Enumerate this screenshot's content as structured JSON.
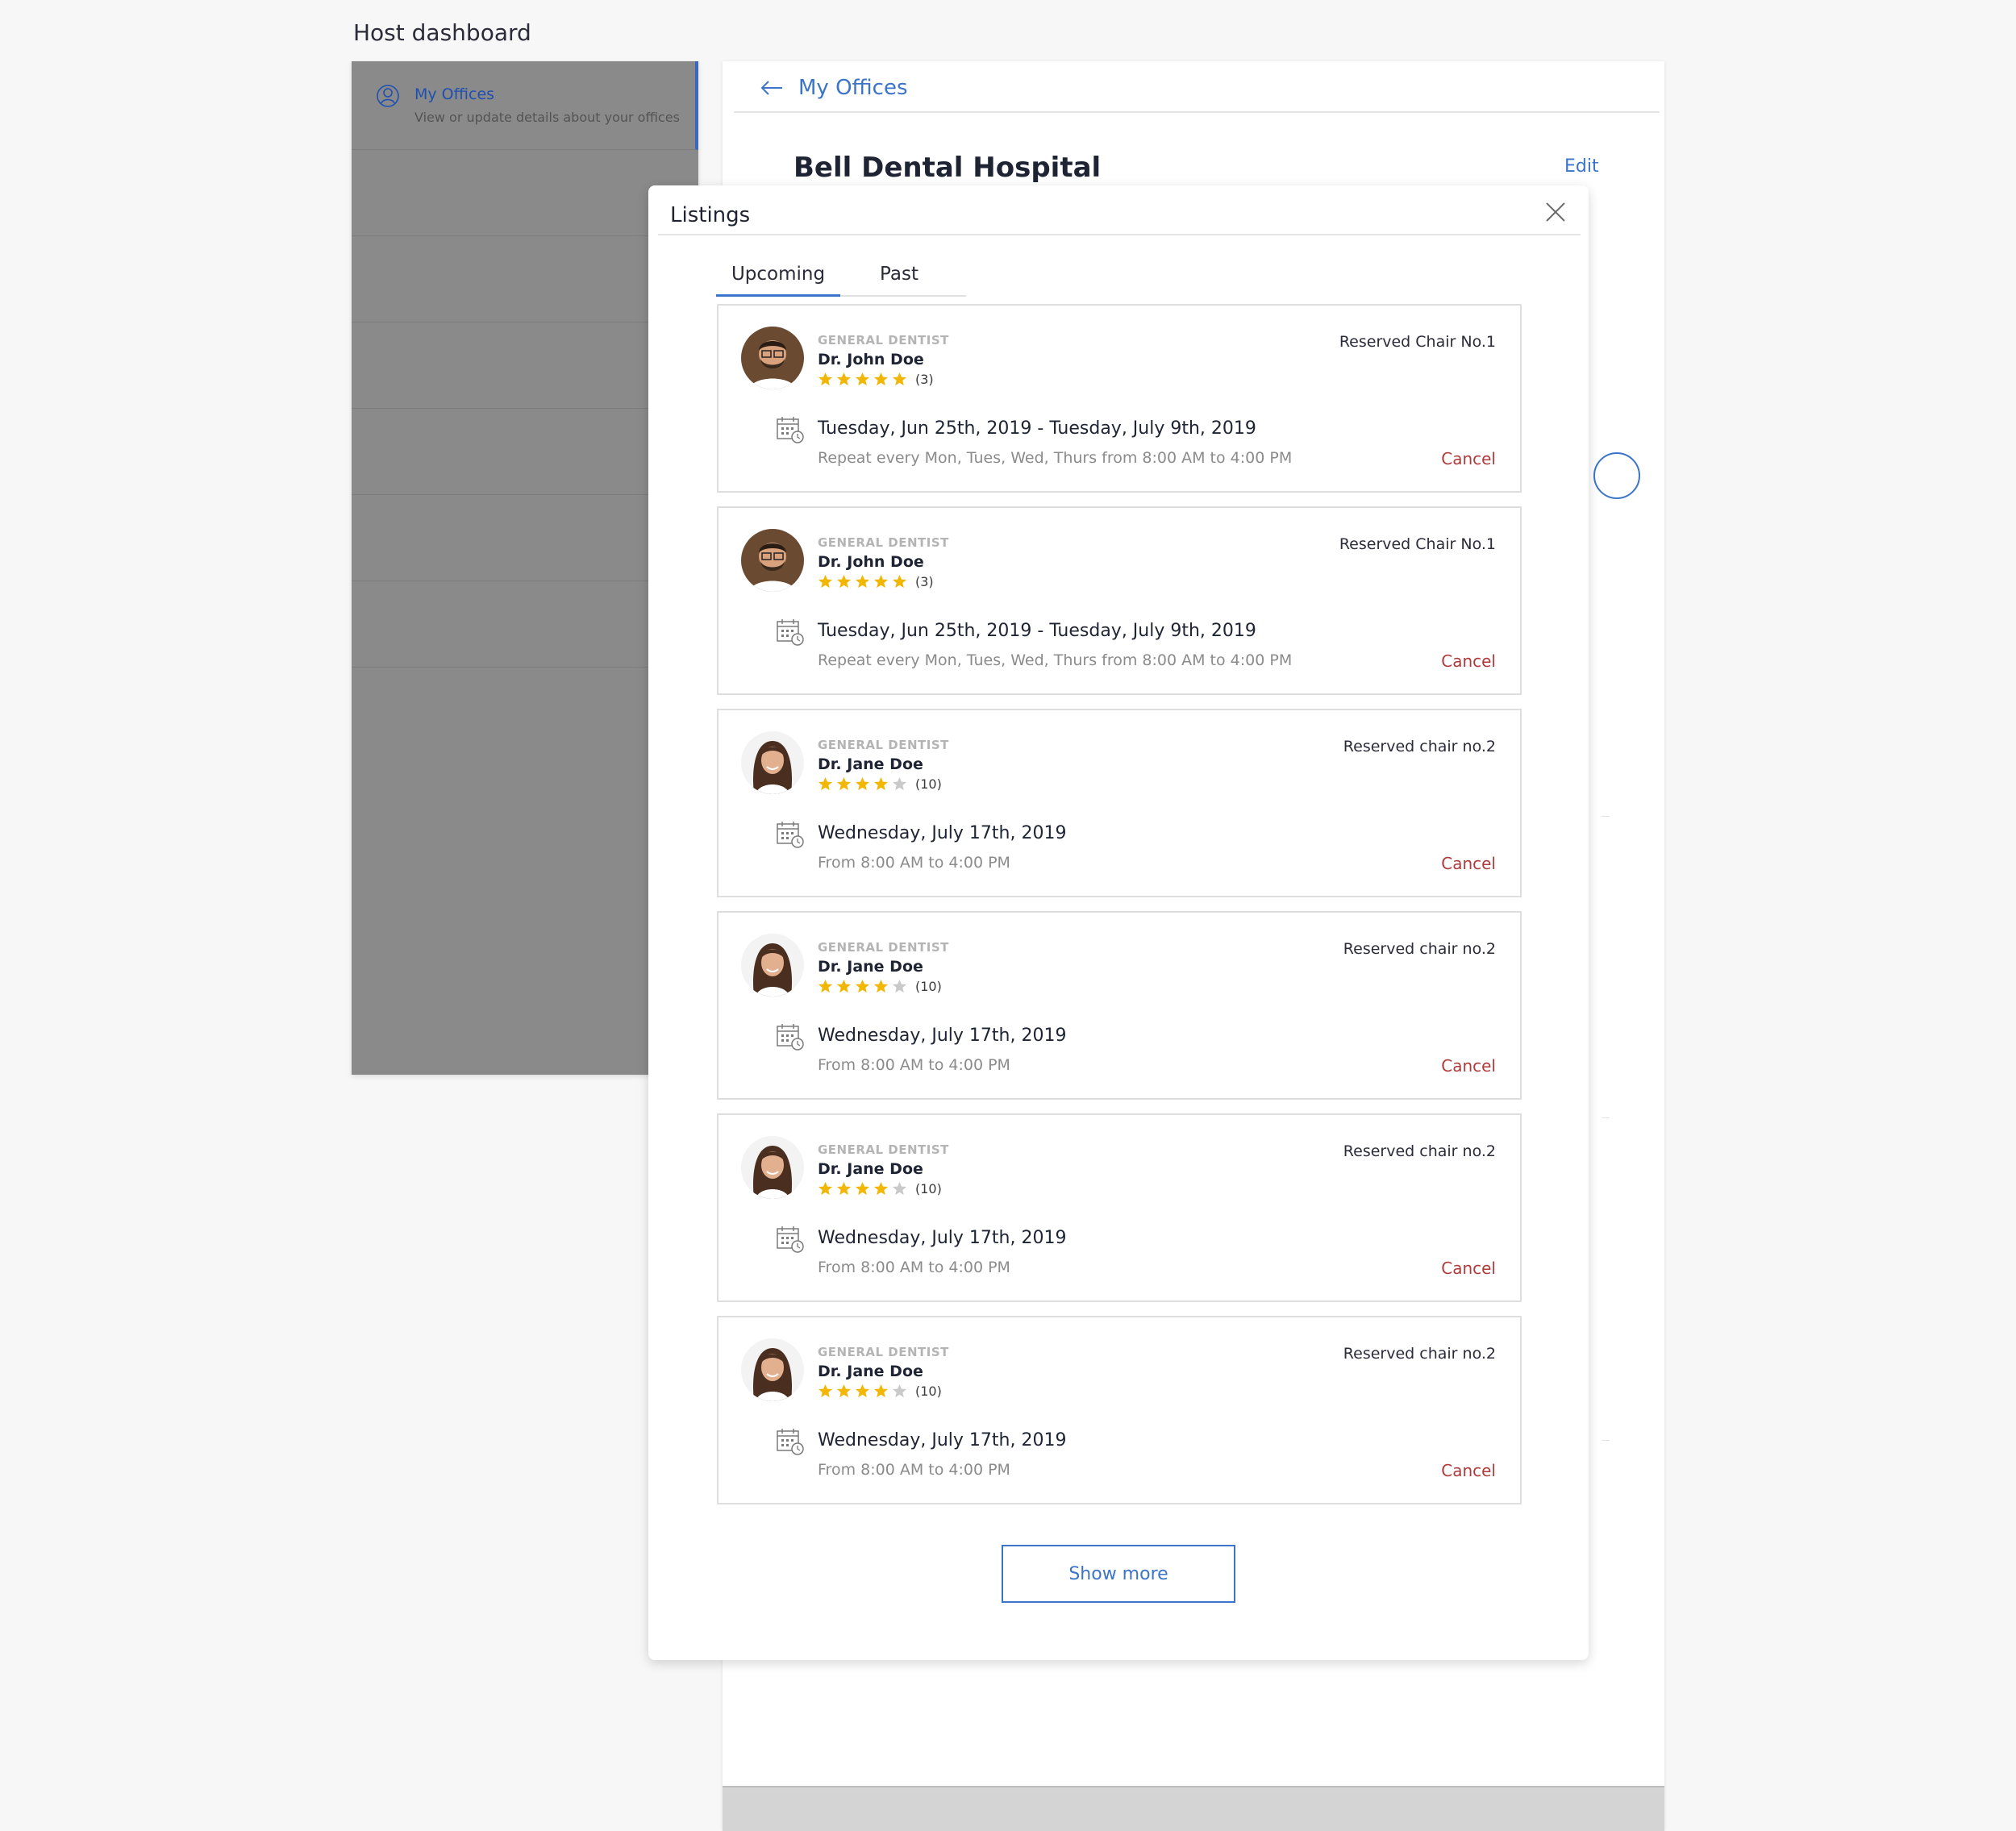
{
  "page": {
    "title": "Host dashboard"
  },
  "sidebar": {
    "items": [
      {
        "label": "My Offices",
        "description": "View or update details about your offices",
        "icon": "user-circle-icon"
      }
    ]
  },
  "main": {
    "back_label": "My Offices",
    "office_name": "Bell Dental Hospital",
    "edit_label": "Edit"
  },
  "modal": {
    "title": "Listings",
    "tabs": [
      {
        "label": "Upcoming",
        "active": true
      },
      {
        "label": "Past",
        "active": false
      }
    ],
    "listings": [
      {
        "specialty": "GENERAL DENTIST",
        "name": "Dr. John Doe",
        "rating": 5,
        "reviews": "(3)",
        "chair": "Reserved Chair No.1",
        "date": "Tuesday, Jun 25th, 2019 - Tuesday,  July 9th, 2019",
        "detail": "Repeat every Mon, Tues, Wed, Thurs from 8:00 AM to 4:00 PM",
        "cancel": "Cancel",
        "avatar": "male"
      },
      {
        "specialty": "GENERAL DENTIST",
        "name": "Dr. John Doe",
        "rating": 5,
        "reviews": "(3)",
        "chair": "Reserved Chair No.1",
        "date": "Tuesday, Jun 25th, 2019 - Tuesday,  July 9th, 2019",
        "detail": "Repeat every Mon, Tues, Wed, Thurs from 8:00 AM to 4:00 PM",
        "cancel": "Cancel",
        "avatar": "male"
      },
      {
        "specialty": "GENERAL DENTIST",
        "name": "Dr. Jane Doe",
        "rating": 4,
        "reviews": "(10)",
        "chair": "Reserved chair no.2",
        "date": "Wednesday, July 17th, 2019",
        "detail": "From 8:00 AM to 4:00 PM",
        "cancel": "Cancel",
        "avatar": "female"
      },
      {
        "specialty": "GENERAL DENTIST",
        "name": "Dr. Jane Doe",
        "rating": 4,
        "reviews": "(10)",
        "chair": "Reserved chair no.2",
        "date": "Wednesday, July 17th, 2019",
        "detail": "From 8:00 AM to 4:00 PM",
        "cancel": "Cancel",
        "avatar": "female"
      },
      {
        "specialty": "GENERAL DENTIST",
        "name": "Dr. Jane Doe",
        "rating": 4,
        "reviews": "(10)",
        "chair": "Reserved chair no.2",
        "date": "Wednesday, July 17th, 2019",
        "detail": "From 8:00 AM to 4:00 PM",
        "cancel": "Cancel",
        "avatar": "female"
      },
      {
        "specialty": "GENERAL DENTIST",
        "name": "Dr. Jane Doe",
        "rating": 4,
        "reviews": "(10)",
        "chair": "Reserved chair no.2",
        "date": "Wednesday, July 17th, 2019",
        "detail": "From 8:00 AM to 4:00 PM",
        "cancel": "Cancel",
        "avatar": "female"
      }
    ],
    "show_more_label": "Show more"
  },
  "colors": {
    "accent": "#3b74c8",
    "cancel": "#b03a3a",
    "star": "#f2b705",
    "star_empty": "#c9c9c9",
    "overlay": "#8a8a8a"
  },
  "icons": {
    "back": "arrow-left-icon",
    "close": "close-icon",
    "calendar": "calendar-clock-icon",
    "star": "star-icon"
  }
}
